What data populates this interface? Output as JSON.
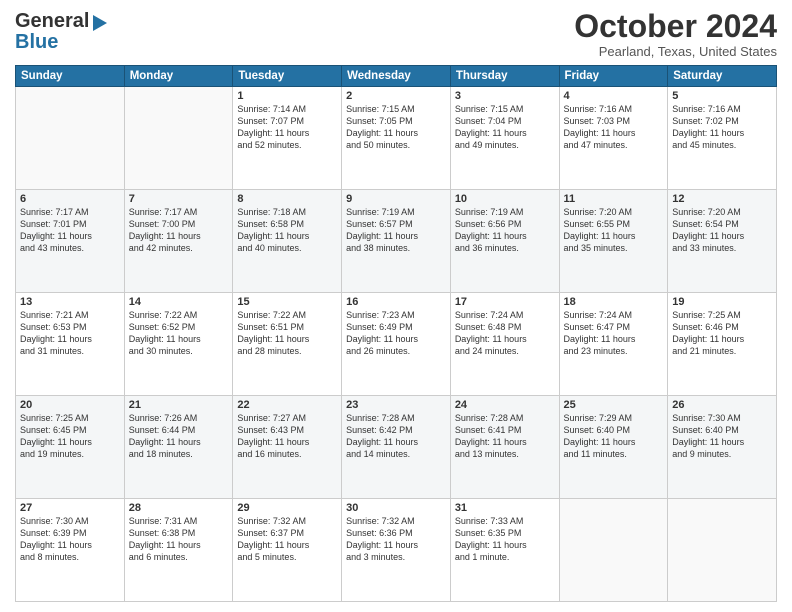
{
  "header": {
    "logo_general": "General",
    "logo_blue": "Blue",
    "month_title": "October 2024",
    "location": "Pearland, Texas, United States"
  },
  "days_of_week": [
    "Sunday",
    "Monday",
    "Tuesday",
    "Wednesday",
    "Thursday",
    "Friday",
    "Saturday"
  ],
  "weeks": [
    [
      {
        "day": "",
        "info": ""
      },
      {
        "day": "",
        "info": ""
      },
      {
        "day": "1",
        "info": "Sunrise: 7:14 AM\nSunset: 7:07 PM\nDaylight: 11 hours\nand 52 minutes."
      },
      {
        "day": "2",
        "info": "Sunrise: 7:15 AM\nSunset: 7:05 PM\nDaylight: 11 hours\nand 50 minutes."
      },
      {
        "day": "3",
        "info": "Sunrise: 7:15 AM\nSunset: 7:04 PM\nDaylight: 11 hours\nand 49 minutes."
      },
      {
        "day": "4",
        "info": "Sunrise: 7:16 AM\nSunset: 7:03 PM\nDaylight: 11 hours\nand 47 minutes."
      },
      {
        "day": "5",
        "info": "Sunrise: 7:16 AM\nSunset: 7:02 PM\nDaylight: 11 hours\nand 45 minutes."
      }
    ],
    [
      {
        "day": "6",
        "info": "Sunrise: 7:17 AM\nSunset: 7:01 PM\nDaylight: 11 hours\nand 43 minutes."
      },
      {
        "day": "7",
        "info": "Sunrise: 7:17 AM\nSunset: 7:00 PM\nDaylight: 11 hours\nand 42 minutes."
      },
      {
        "day": "8",
        "info": "Sunrise: 7:18 AM\nSunset: 6:58 PM\nDaylight: 11 hours\nand 40 minutes."
      },
      {
        "day": "9",
        "info": "Sunrise: 7:19 AM\nSunset: 6:57 PM\nDaylight: 11 hours\nand 38 minutes."
      },
      {
        "day": "10",
        "info": "Sunrise: 7:19 AM\nSunset: 6:56 PM\nDaylight: 11 hours\nand 36 minutes."
      },
      {
        "day": "11",
        "info": "Sunrise: 7:20 AM\nSunset: 6:55 PM\nDaylight: 11 hours\nand 35 minutes."
      },
      {
        "day": "12",
        "info": "Sunrise: 7:20 AM\nSunset: 6:54 PM\nDaylight: 11 hours\nand 33 minutes."
      }
    ],
    [
      {
        "day": "13",
        "info": "Sunrise: 7:21 AM\nSunset: 6:53 PM\nDaylight: 11 hours\nand 31 minutes."
      },
      {
        "day": "14",
        "info": "Sunrise: 7:22 AM\nSunset: 6:52 PM\nDaylight: 11 hours\nand 30 minutes."
      },
      {
        "day": "15",
        "info": "Sunrise: 7:22 AM\nSunset: 6:51 PM\nDaylight: 11 hours\nand 28 minutes."
      },
      {
        "day": "16",
        "info": "Sunrise: 7:23 AM\nSunset: 6:49 PM\nDaylight: 11 hours\nand 26 minutes."
      },
      {
        "day": "17",
        "info": "Sunrise: 7:24 AM\nSunset: 6:48 PM\nDaylight: 11 hours\nand 24 minutes."
      },
      {
        "day": "18",
        "info": "Sunrise: 7:24 AM\nSunset: 6:47 PM\nDaylight: 11 hours\nand 23 minutes."
      },
      {
        "day": "19",
        "info": "Sunrise: 7:25 AM\nSunset: 6:46 PM\nDaylight: 11 hours\nand 21 minutes."
      }
    ],
    [
      {
        "day": "20",
        "info": "Sunrise: 7:25 AM\nSunset: 6:45 PM\nDaylight: 11 hours\nand 19 minutes."
      },
      {
        "day": "21",
        "info": "Sunrise: 7:26 AM\nSunset: 6:44 PM\nDaylight: 11 hours\nand 18 minutes."
      },
      {
        "day": "22",
        "info": "Sunrise: 7:27 AM\nSunset: 6:43 PM\nDaylight: 11 hours\nand 16 minutes."
      },
      {
        "day": "23",
        "info": "Sunrise: 7:28 AM\nSunset: 6:42 PM\nDaylight: 11 hours\nand 14 minutes."
      },
      {
        "day": "24",
        "info": "Sunrise: 7:28 AM\nSunset: 6:41 PM\nDaylight: 11 hours\nand 13 minutes."
      },
      {
        "day": "25",
        "info": "Sunrise: 7:29 AM\nSunset: 6:40 PM\nDaylight: 11 hours\nand 11 minutes."
      },
      {
        "day": "26",
        "info": "Sunrise: 7:30 AM\nSunset: 6:40 PM\nDaylight: 11 hours\nand 9 minutes."
      }
    ],
    [
      {
        "day": "27",
        "info": "Sunrise: 7:30 AM\nSunset: 6:39 PM\nDaylight: 11 hours\nand 8 minutes."
      },
      {
        "day": "28",
        "info": "Sunrise: 7:31 AM\nSunset: 6:38 PM\nDaylight: 11 hours\nand 6 minutes."
      },
      {
        "day": "29",
        "info": "Sunrise: 7:32 AM\nSunset: 6:37 PM\nDaylight: 11 hours\nand 5 minutes."
      },
      {
        "day": "30",
        "info": "Sunrise: 7:32 AM\nSunset: 6:36 PM\nDaylight: 11 hours\nand 3 minutes."
      },
      {
        "day": "31",
        "info": "Sunrise: 7:33 AM\nSunset: 6:35 PM\nDaylight: 11 hours\nand 1 minute."
      },
      {
        "day": "",
        "info": ""
      },
      {
        "day": "",
        "info": ""
      }
    ]
  ]
}
